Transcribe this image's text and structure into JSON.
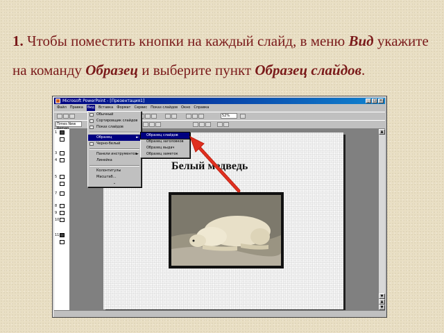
{
  "instruction": {
    "number": "1.",
    "text_1": " Чтобы поместить кнопки на каждый слайд, в меню ",
    "menu_name": "Вид",
    "text_2": " укажите на команду ",
    "command_name": "Образец",
    "text_3": " и выберите пункт ",
    "item_name": "Образец слайдов",
    "text_end": "."
  },
  "window": {
    "title": "Microsoft PowerPoint - [Презентация1]",
    "menu_items": [
      "Файл",
      "Правка",
      "Вид",
      "Вставка",
      "Формат",
      "Сервис",
      "Показ слайдов",
      "Окно",
      "Справка"
    ],
    "active_menu_index": 2,
    "zoom": "52%",
    "font_select": "Times New Roman",
    "outline_numbers": [
      "1",
      "2",
      "3",
      "4",
      "5",
      "6",
      "7",
      "8",
      "9",
      "10",
      "11"
    ]
  },
  "view_menu": {
    "items": [
      "Обычный",
      "Сортировщик слайдов",
      "Показ слайдов",
      "Образец",
      "Черно-белый",
      "Панели инструментов",
      "Линейка",
      "Колонтитулы",
      "Масштаб..."
    ],
    "selected_index": 3
  },
  "master_submenu": {
    "items": [
      "Образец слайдов",
      "Образец заголовков",
      "Образец выдач",
      "Образец заметок"
    ],
    "selected_index": 0
  },
  "slide": {
    "title": "Белый медведь"
  },
  "colors": {
    "instruction_text": "#7a1a1a",
    "background": "#e9dfc4",
    "arrow": "#e03020",
    "titlebar": "#000080"
  }
}
